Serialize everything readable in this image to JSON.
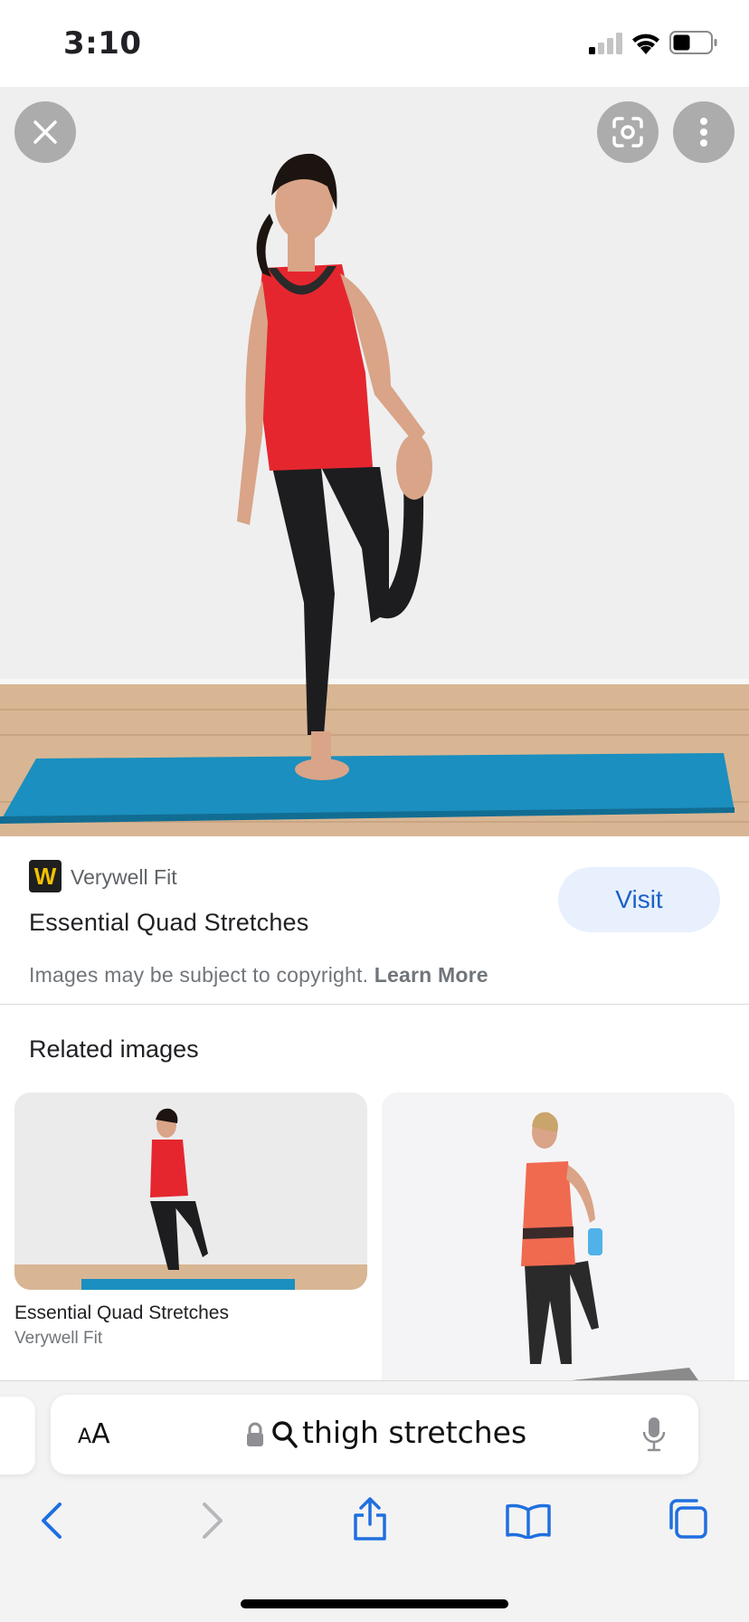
{
  "status_bar": {
    "time": "3:10",
    "icons": [
      "signal-icon",
      "wifi-icon",
      "battery-icon"
    ]
  },
  "image_viewer": {
    "buttons": [
      "close-icon",
      "lens-icon",
      "more-icon"
    ]
  },
  "source": {
    "site_name": "Verywell Fit",
    "logo_letter": "W",
    "title": "Essential Quad Stretches",
    "visit_label": "Visit",
    "copyright_text": "Images may be subject to copyright.",
    "learn_more_label": "Learn More"
  },
  "related": {
    "heading": "Related images",
    "items": [
      {
        "title": "Essential Quad Stretches",
        "source": "Verywell Fit"
      },
      {
        "title": "",
        "source": ""
      }
    ]
  },
  "browser": {
    "text_size_label_small": "A",
    "text_size_label_large": "A",
    "address": "thigh stretches",
    "toolbar": [
      "back-icon",
      "forward-icon",
      "share-icon",
      "bookmarks-icon",
      "tabs-icon"
    ]
  },
  "colors": {
    "accent": "#1a62c7",
    "visit_bg": "#e8f0fe",
    "mat_blue": "#1b8fbf",
    "shirt_red": "#e5262e"
  }
}
